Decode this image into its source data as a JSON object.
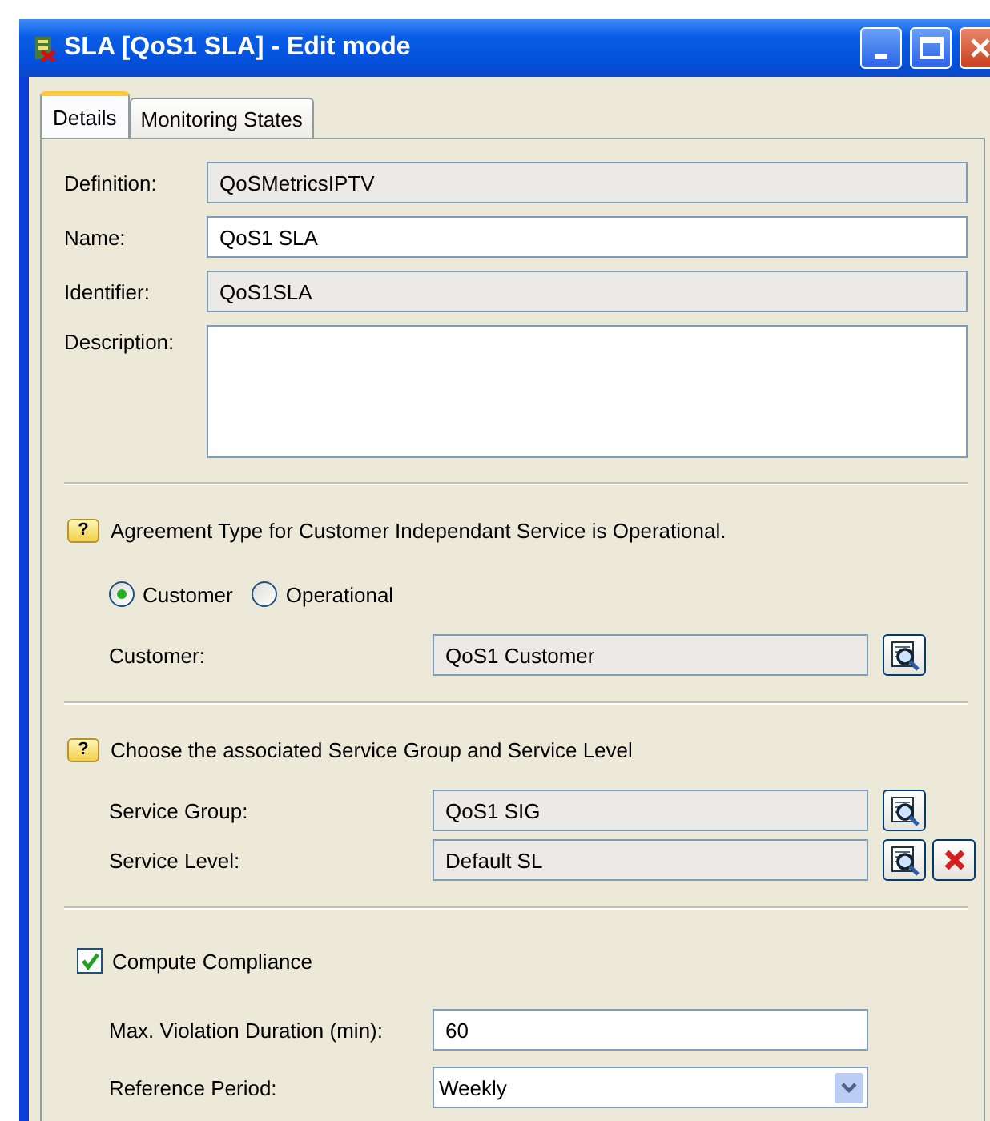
{
  "window": {
    "title": "SLA [QoS1 SLA] - Edit mode"
  },
  "tabs": [
    {
      "label": "Details",
      "selected": true
    },
    {
      "label": "Monitoring States",
      "selected": false
    }
  ],
  "general_fields": [
    {
      "label": "Definition:",
      "kind": "readonly",
      "value": "QoSMetricsIPTV"
    },
    {
      "label": "Name:",
      "kind": "text",
      "value": "QoS1 SLA"
    },
    {
      "label": "Identifier:",
      "kind": "readonly",
      "value": "QoS1SLA"
    },
    {
      "label": "Description:",
      "kind": "textarea"
    }
  ],
  "agreement": {
    "hint_badge": "?",
    "hint": "Agreement Type for Customer Independant Service is Operational.",
    "options": [
      {
        "label": "Customer",
        "selected": true
      },
      {
        "label": "Operational",
        "selected": false
      }
    ],
    "fields": [
      {
        "label": "Customer:",
        "kind": "lookup",
        "value": "QoS1 Customer"
      }
    ]
  },
  "service": {
    "hint_badge": "?",
    "hint": "Choose the associated Service Group and Service Level",
    "fields": [
      {
        "label": "Service Group:",
        "kind": "lookup",
        "value": "QoS1 SIG"
      },
      {
        "label": "Service Level:",
        "kind": "lookup_clear",
        "value": "Default SL"
      }
    ]
  },
  "compliance": {
    "label": "Compute Compliance",
    "checked": true,
    "fields": [
      {
        "label": "Max. Violation Duration (min):",
        "kind": "text",
        "value": "60"
      },
      {
        "label": "Reference Period:",
        "kind": "dropdown",
        "value": "Weekly"
      }
    ]
  }
}
